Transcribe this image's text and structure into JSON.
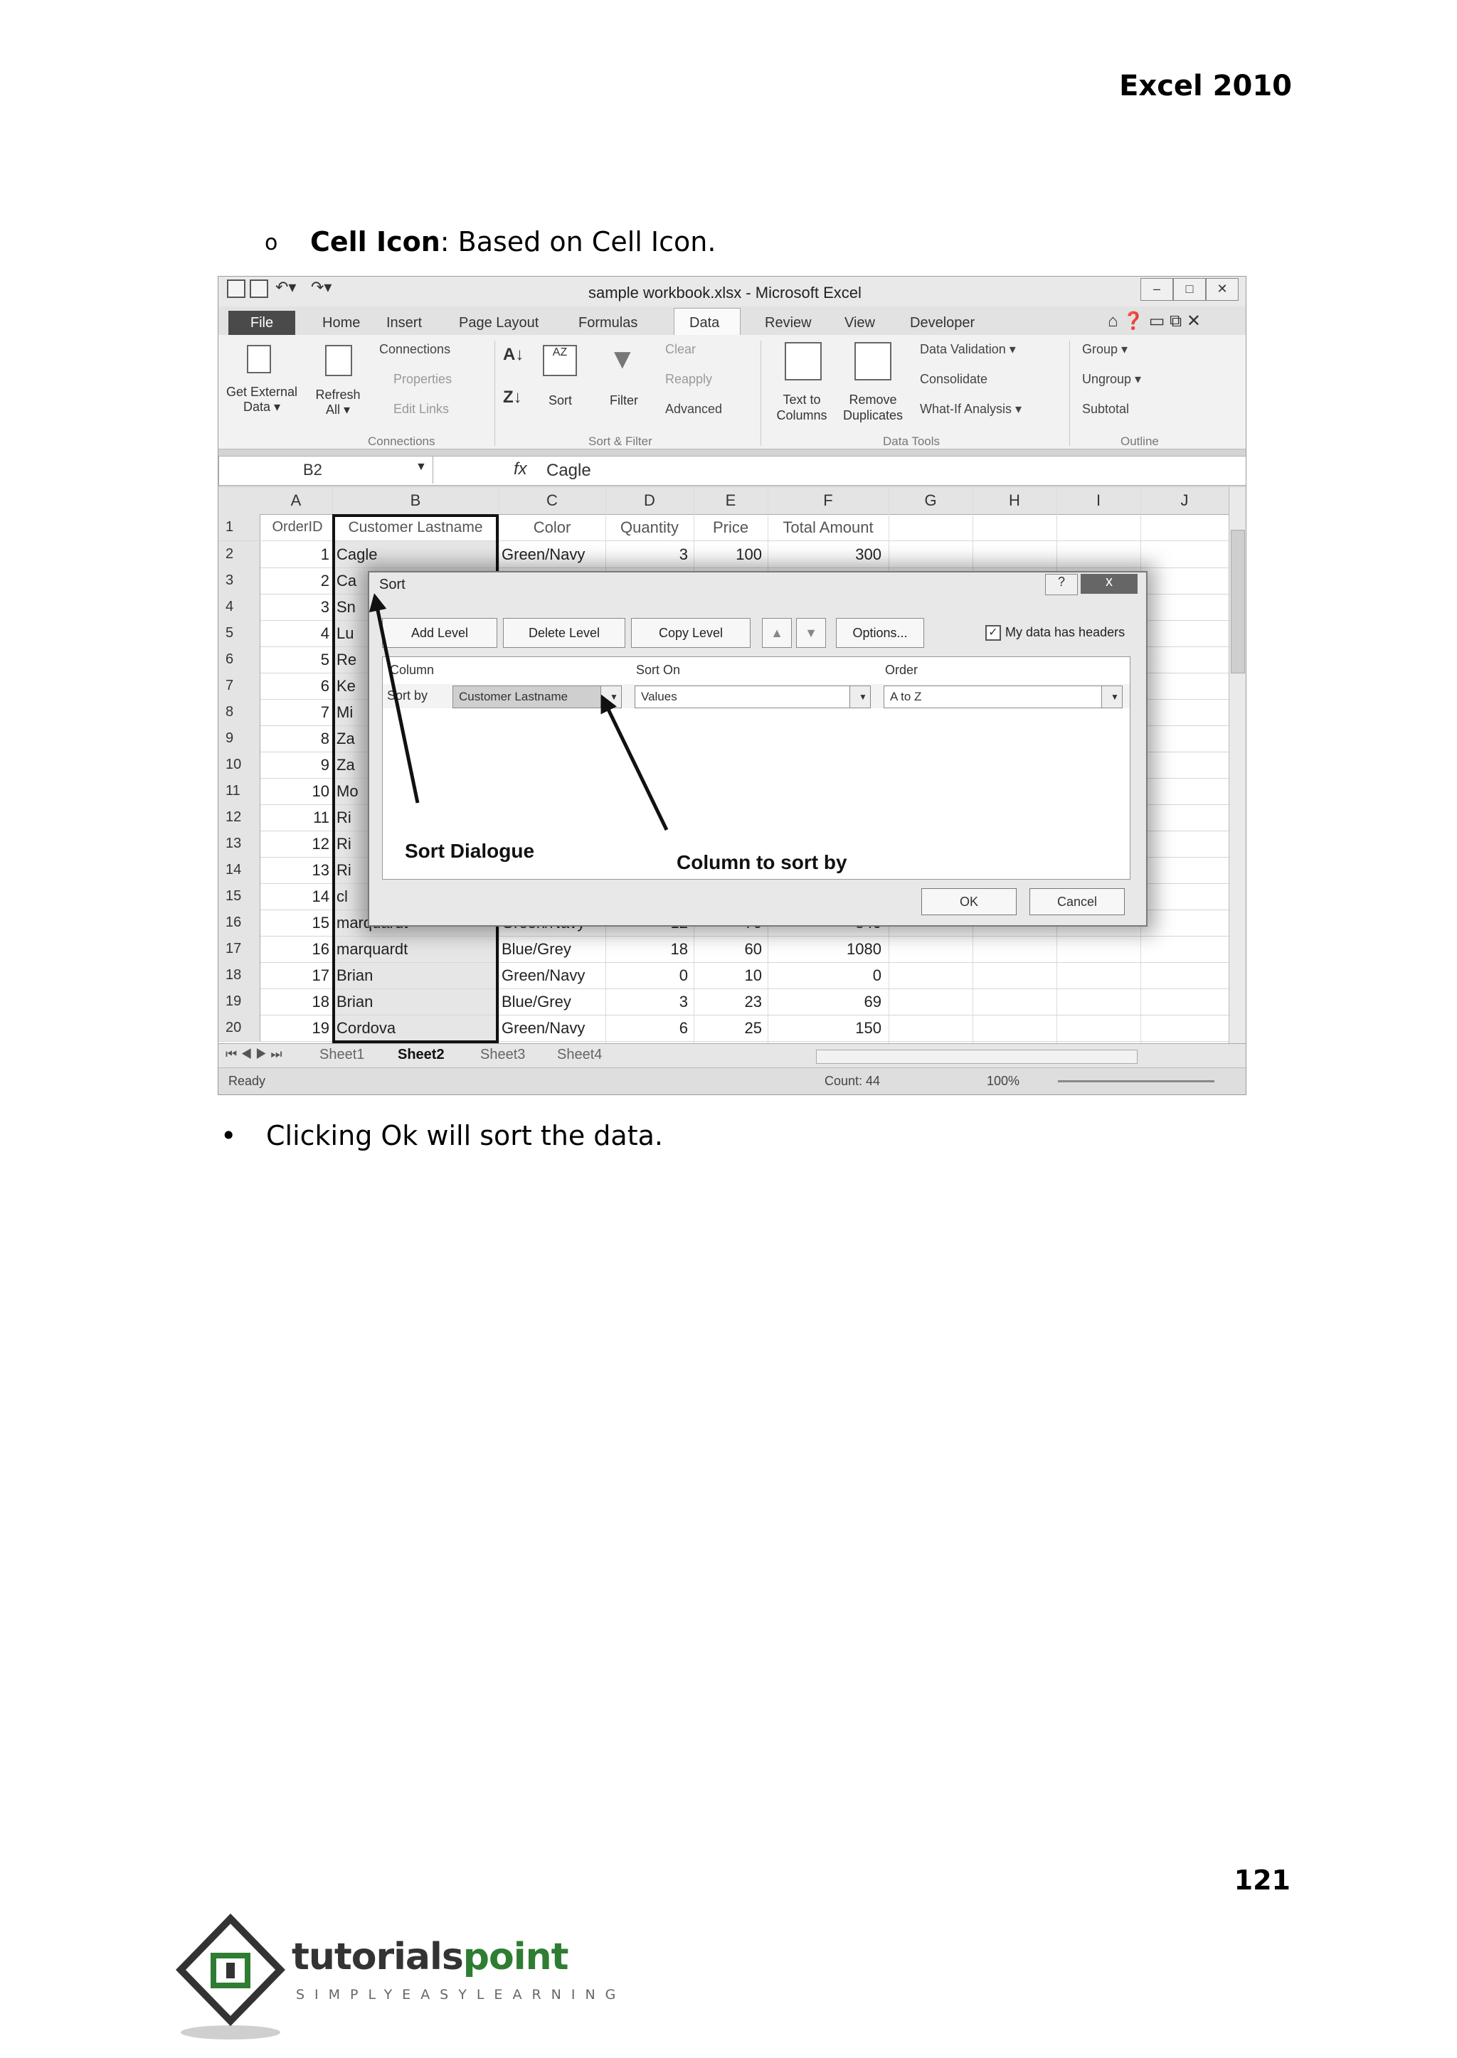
{
  "header": {
    "book_title": "Excel 2010"
  },
  "bullet1": {
    "marker": "o",
    "bold": "Cell Icon",
    "rest": ": Based on Cell Icon."
  },
  "bullet2": {
    "marker": "•",
    "text": "Clicking Ok will sort the data."
  },
  "page_number": "121",
  "excel": {
    "window_title": "sample workbook.xlsx - Microsoft Excel",
    "tabs": [
      "File",
      "Home",
      "Insert",
      "Page Layout",
      "Formulas",
      "Data",
      "Review",
      "View",
      "Developer"
    ],
    "ribbon": {
      "get_external_data": "Get External Data ▾",
      "refresh_all": "Refresh All ▾",
      "connections": "Connections",
      "properties": "Properties",
      "edit_links": "Edit Links",
      "group_connections": "Connections",
      "sort": "Sort",
      "filter": "Filter",
      "clear": "Clear",
      "reapply": "Reapply",
      "advanced": "Advanced",
      "group_sort_filter": "Sort & Filter",
      "text_to_columns": "Text to Columns",
      "remove_duplicates": "Remove Duplicates",
      "data_validation": "Data Validation ▾",
      "consolidate": "Consolidate",
      "what_if": "What-If Analysis ▾",
      "group_data_tools": "Data Tools",
      "group": "Group ▾",
      "ungroup": "Ungroup ▾",
      "subtotal": "Subtotal",
      "group_outline": "Outline"
    },
    "name_box": "B2",
    "fx": "fx",
    "formula_value": "Cagle",
    "columns": [
      "A",
      "B",
      "C",
      "D",
      "E",
      "F",
      "G",
      "H",
      "I",
      "J"
    ],
    "header_row": [
      "OrderID",
      "Customer Lastname",
      "Color",
      "Quantity",
      "Price",
      "Total Amount"
    ],
    "rows": [
      {
        "n": "2",
        "a": "1",
        "b": "Cagle",
        "c": "Green/Navy",
        "d": "3",
        "e": "100",
        "f": "300"
      },
      {
        "n": "3",
        "a": "2",
        "b": "Ca",
        "c": "",
        "d": "",
        "e": "",
        "f": ""
      },
      {
        "n": "4",
        "a": "3",
        "b": "Sn",
        "c": "",
        "d": "",
        "e": "",
        "f": ""
      },
      {
        "n": "5",
        "a": "4",
        "b": "Lu",
        "c": "",
        "d": "",
        "e": "",
        "f": ""
      },
      {
        "n": "6",
        "a": "5",
        "b": "Re",
        "c": "",
        "d": "",
        "e": "",
        "f": ""
      },
      {
        "n": "7",
        "a": "6",
        "b": "Ke",
        "c": "",
        "d": "",
        "e": "",
        "f": ""
      },
      {
        "n": "8",
        "a": "7",
        "b": "Mi",
        "c": "",
        "d": "",
        "e": "",
        "f": ""
      },
      {
        "n": "9",
        "a": "8",
        "b": "Za",
        "c": "",
        "d": "",
        "e": "",
        "f": ""
      },
      {
        "n": "10",
        "a": "9",
        "b": "Za",
        "c": "",
        "d": "",
        "e": "",
        "f": ""
      },
      {
        "n": "11",
        "a": "10",
        "b": "Mo",
        "c": "",
        "d": "",
        "e": "",
        "f": ""
      },
      {
        "n": "12",
        "a": "11",
        "b": "Ri",
        "c": "",
        "d": "",
        "e": "",
        "f": ""
      },
      {
        "n": "13",
        "a": "12",
        "b": "Ri",
        "c": "",
        "d": "",
        "e": "",
        "f": ""
      },
      {
        "n": "14",
        "a": "13",
        "b": "Ri",
        "c": "",
        "d": "",
        "e": "",
        "f": ""
      },
      {
        "n": "15",
        "a": "14",
        "b": "cl",
        "c": "",
        "d": "",
        "e": "",
        "f": ""
      },
      {
        "n": "16",
        "a": "15",
        "b": "marquardt",
        "c": "Green/Navy",
        "d": "12",
        "e": "70",
        "f": "840"
      },
      {
        "n": "17",
        "a": "16",
        "b": "marquardt",
        "c": "Blue/Grey",
        "d": "18",
        "e": "60",
        "f": "1080"
      },
      {
        "n": "18",
        "a": "17",
        "b": "Brian",
        "c": "Green/Navy",
        "d": "0",
        "e": "10",
        "f": "0"
      },
      {
        "n": "19",
        "a": "18",
        "b": "Brian",
        "c": "Blue/Grey",
        "d": "3",
        "e": "23",
        "f": "69"
      },
      {
        "n": "20",
        "a": "19",
        "b": "Cordova",
        "c": "Green/Navy",
        "d": "6",
        "e": "25",
        "f": "150"
      }
    ],
    "sheets": [
      "Sheet1",
      "Sheet2",
      "Sheet3",
      "Sheet4"
    ],
    "status": {
      "ready": "Ready",
      "count": "Count: 44",
      "zoom": "100%"
    },
    "sort_dialog": {
      "title": "Sort",
      "help": "?",
      "close": "x",
      "add_level": "Add Level",
      "delete_level": "Delete Level",
      "copy_level": "Copy Level",
      "up": "▲",
      "down": "▼",
      "options": "Options...",
      "check": "✓",
      "my_data_has_headers": "My data has headers",
      "col_header": "Column",
      "sort_on_header": "Sort On",
      "order_header": "Order",
      "sort_by": "Sort by",
      "column_value": "Customer Lastname",
      "sort_on_value": "Values",
      "order_value": "A to Z",
      "ok": "OK",
      "cancel": "Cancel"
    },
    "annotations": {
      "sort_dialogue": "Sort Dialogue",
      "column_to_sort_by": "Column to sort by"
    }
  },
  "logo": {
    "name_a": "tutorials",
    "name_b": "point",
    "tagline": "SIMPLYEASYLEARNING"
  }
}
